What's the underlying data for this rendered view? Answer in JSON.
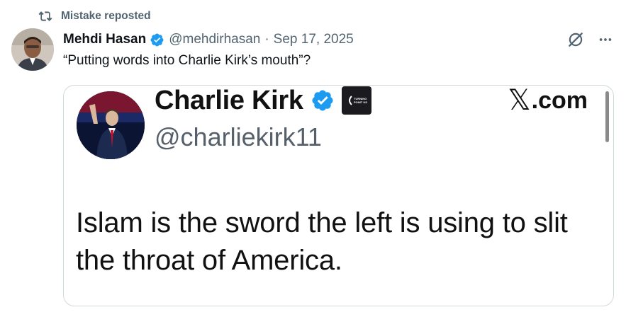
{
  "repost": {
    "label": "Mistake reposted",
    "icon": "repost-icon"
  },
  "post": {
    "author_name": "Mehdi Hasan",
    "author_handle": "@mehdirhasan",
    "separator": "·",
    "date": "Sep 17, 2025",
    "text": "“Putting words into Charlie Kirk’s mouth”?",
    "icons": [
      "verified-badge-icon",
      "grok-icon",
      "more-icon"
    ],
    "accent_color": "#1d9bf0"
  },
  "media": {
    "quoted_name": "Charlie Kirk",
    "quoted_handle": "@charliekirk11",
    "site_label": ".com",
    "site_glyph": "𝕏",
    "logo_text": "TURNING POINT USA",
    "quote_text": "Islam is the sword the left is using to slit the throat of America."
  }
}
